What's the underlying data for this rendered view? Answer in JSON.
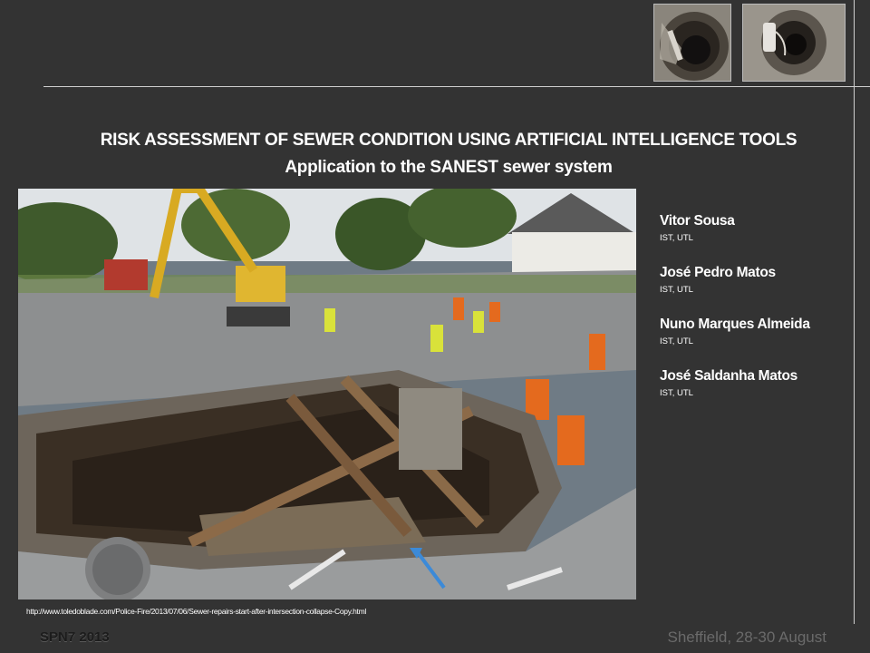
{
  "slide": {
    "title": "RISK ASSESSMENT  OF SEWER CONDITION USING ARTIFICIAL INTELLIGENCE TOOLS",
    "subtitle": "Application to the SANEST sewer system",
    "source_url": "http://www.toledoblade.com/Police-Fire/2013/07/06/Sewer-repairs-start-after-intersection-collapse-Copy.html"
  },
  "authors": [
    {
      "name": "Vitor Sousa",
      "affiliation": "IST, UTL"
    },
    {
      "name": "José Pedro Matos",
      "affiliation": "IST, UTL"
    },
    {
      "name": "Nuno Marques Almeida",
      "affiliation": "IST, UTL"
    },
    {
      "name": "José Saldanha Matos",
      "affiliation": "IST, UTL"
    }
  ],
  "footer": {
    "conference": "SPN7 2013",
    "location": "Sheffield, 28-30 August"
  },
  "colors": {
    "background": "#333333",
    "text": "#ffffff",
    "rule": "#cfcfcf"
  }
}
